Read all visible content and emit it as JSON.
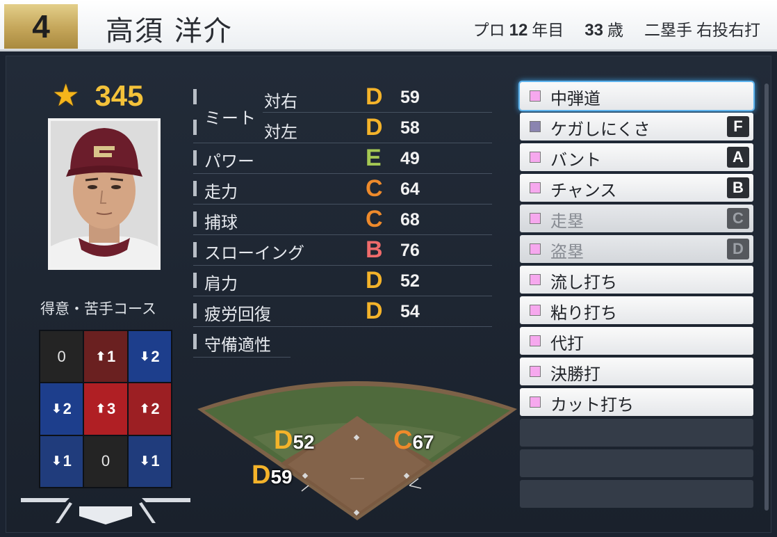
{
  "header": {
    "number": "4",
    "name": "高須 洋介",
    "years_prefix": "プロ",
    "years": "12",
    "years_suffix": "年目",
    "age": "33",
    "age_suffix": "歳",
    "position": "二塁手",
    "handedness": "右投右打"
  },
  "rating": {
    "value": "345"
  },
  "course": {
    "title": "得意・苦手コース",
    "cells": [
      {
        "arrow": "",
        "value": "0",
        "type": "neutral"
      },
      {
        "arrow": "up",
        "value": "1",
        "type": "hot1"
      },
      {
        "arrow": "down",
        "value": "2",
        "type": "cold2"
      },
      {
        "arrow": "down",
        "value": "2",
        "type": "cold2"
      },
      {
        "arrow": "up",
        "value": "3",
        "type": "hot3"
      },
      {
        "arrow": "up",
        "value": "2",
        "type": "hot2"
      },
      {
        "arrow": "down",
        "value": "1",
        "type": "cold1"
      },
      {
        "arrow": "",
        "value": "0",
        "type": "neutral"
      },
      {
        "arrow": "down",
        "value": "1",
        "type": "cold1"
      }
    ]
  },
  "stats": {
    "meat_label": "ミート",
    "meat_right": {
      "label": "対右",
      "grade": "D",
      "value": "59"
    },
    "meat_left": {
      "label": "対左",
      "grade": "D",
      "value": "58"
    },
    "power": {
      "label": "パワー",
      "grade": "E",
      "value": "49"
    },
    "speed": {
      "label": "走力",
      "grade": "C",
      "value": "64"
    },
    "fielding": {
      "label": "捕球",
      "grade": "C",
      "value": "68"
    },
    "throwing": {
      "label": "スローイング",
      "grade": "B",
      "value": "76"
    },
    "arm": {
      "label": "肩力",
      "grade": "D",
      "value": "52"
    },
    "recovery": {
      "label": "疲労回復",
      "grade": "D",
      "value": "54"
    },
    "defense_label": "守備適性"
  },
  "positions": [
    {
      "grade": "D",
      "value": "52",
      "spot": "first"
    },
    {
      "grade": "C",
      "value": "67",
      "spot": "second"
    },
    {
      "grade": "D",
      "value": "59",
      "spot": "third"
    }
  ],
  "abilities": [
    {
      "label": "中弾道",
      "grade": "",
      "color": "#f6a8ee",
      "state": "selected"
    },
    {
      "label": "ケガしにくさ",
      "grade": "F",
      "color": "#8a84b0",
      "state": "normal"
    },
    {
      "label": "バント",
      "grade": "A",
      "color": "#f6a8ee",
      "state": "normal"
    },
    {
      "label": "チャンス",
      "grade": "B",
      "color": "#f6a8ee",
      "state": "normal"
    },
    {
      "label": "走塁",
      "grade": "C",
      "color": "#f6a8ee",
      "state": "dim"
    },
    {
      "label": "盗塁",
      "grade": "D",
      "color": "#f6a8ee",
      "state": "dim"
    },
    {
      "label": "流し打ち",
      "grade": "",
      "color": "#f6a8ee",
      "state": "normal"
    },
    {
      "label": "粘り打ち",
      "grade": "",
      "color": "#f6a8ee",
      "state": "normal"
    },
    {
      "label": "代打",
      "grade": "",
      "color": "#f6a8ee",
      "state": "normal"
    },
    {
      "label": "決勝打",
      "grade": "",
      "color": "#f6a8ee",
      "state": "normal"
    },
    {
      "label": "カット打ち",
      "grade": "",
      "color": "#f6a8ee",
      "state": "normal"
    }
  ],
  "empty_slots": 3,
  "colors": {
    "grade_D": "#f4b32a",
    "grade_E": "#a4c853",
    "grade_C": "#ee8a2b",
    "grade_B": "#ef6b6b",
    "rating_gold": "#f4c23a",
    "number_gold": "#c4a559"
  }
}
